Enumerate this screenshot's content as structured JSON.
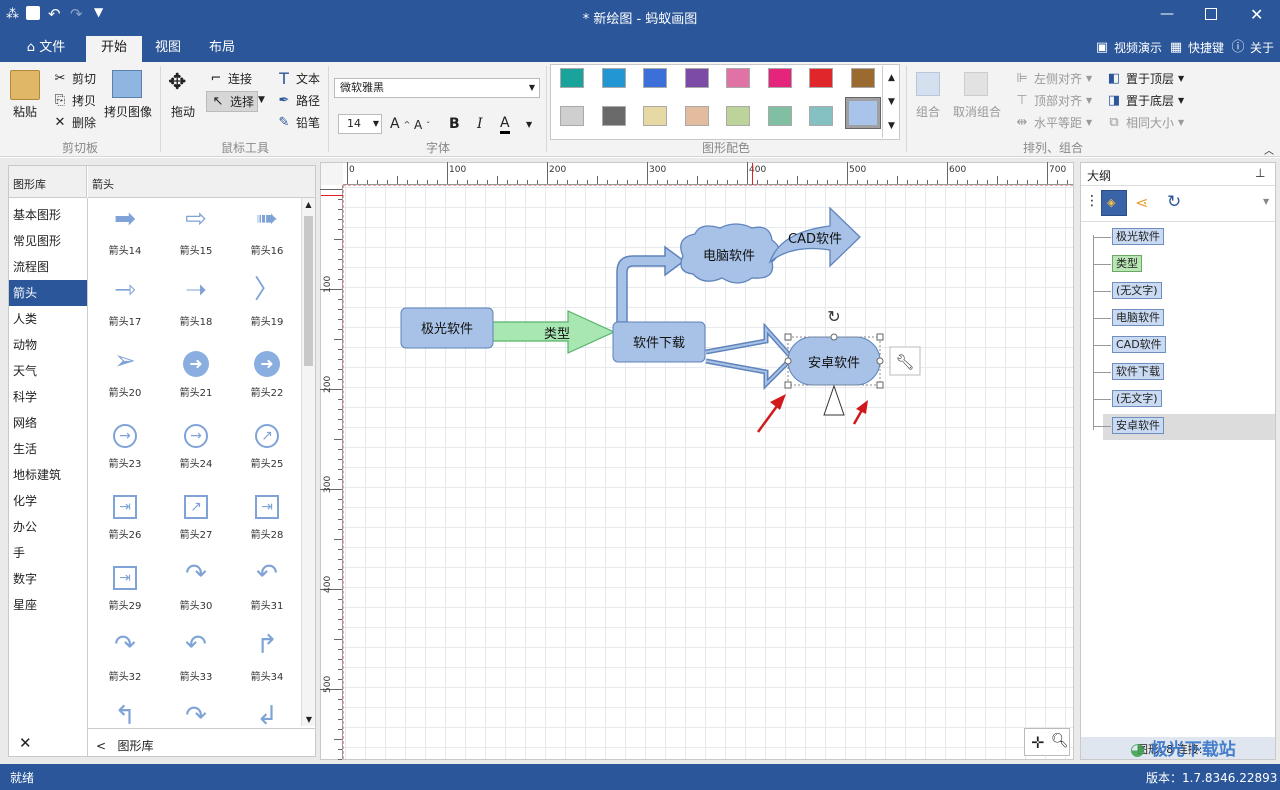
{
  "title": "* 新绘图 - 蚂蚁画图",
  "tabs": [
    "文件",
    "开始",
    "视图",
    "布局"
  ],
  "top_right": {
    "video": "视频演示",
    "shortcuts": "快捷键",
    "about": "关于"
  },
  "clipboard": {
    "paste": "粘贴",
    "cut": "剪切",
    "copy": "拷贝",
    "delete": "删除",
    "copy_image": "拷贝图像",
    "group_label": "剪切板"
  },
  "mouse_tools": {
    "drag": "拖动",
    "connect": "连接",
    "select": "选择",
    "text": "文本",
    "path": "路径",
    "pencil": "铅笔",
    "group_label": "鼠标工具"
  },
  "font": {
    "family": "微软雅黑",
    "size": "14",
    "bold": "B",
    "italic": "I",
    "color": "A",
    "grow": "A",
    "shrink": "A",
    "group_label": "字体"
  },
  "colors": {
    "group_label": "图形配色",
    "row1": [
      "#1aa39b",
      "#2196d3",
      "#3c6fd8",
      "#7b4ba6",
      "#e072a6",
      "#e5247b",
      "#e0262a",
      "#9a6a30"
    ],
    "row2": [
      "#cfcfcf",
      "#6a6a6a",
      "#e6d9a6",
      "#e3bb9f",
      "#bcd39a",
      "#80bfa1",
      "#85c0c2",
      "#a9c4ea"
    ]
  },
  "arrange": {
    "group": "组合",
    "ungroup": "取消组合",
    "align_left": "左侧对齐",
    "align_top": "顶部对齐",
    "equal_h": "水平等距",
    "to_top": "置于顶层",
    "to_bottom": "置于底层",
    "same_size": "相同大小",
    "group_label": "排列、组合"
  },
  "library": {
    "header": "图形库",
    "sub_header": "箭头",
    "categories": [
      "基本图形",
      "常见图形",
      "流程图",
      "箭头",
      "人类",
      "动物",
      "天气",
      "科学",
      "网络",
      "生活",
      "地标建筑",
      "化学",
      "办公",
      "手",
      "数字",
      "星座"
    ],
    "selected": "箭头",
    "shapes": [
      "箭头14",
      "箭头15",
      "箭头16",
      "箭头17",
      "箭头18",
      "箭头19",
      "箭头20",
      "箭头21",
      "箭头22",
      "箭头23",
      "箭头24",
      "箭头25",
      "箭头26",
      "箭头27",
      "箭头28",
      "箭头29",
      "箭头30",
      "箭头31",
      "箭头32",
      "箭头33",
      "箭头34"
    ],
    "footer": "图形库",
    "close": "✕"
  },
  "ruler": {
    "h": [
      "0",
      "100",
      "200",
      "300",
      "400",
      "500",
      "600",
      "700"
    ],
    "v": [
      "100",
      "200",
      "300",
      "400",
      "500"
    ]
  },
  "diagram": {
    "n1": "极光软件",
    "label": "类型",
    "n2": "软件下载",
    "n3": "电脑软件",
    "n4": "CAD软件",
    "n5": "安卓软件"
  },
  "outline": {
    "title": "大纲",
    "items": [
      "极光软件",
      "类型",
      "(无文字)",
      "电脑软件",
      "CAD软件",
      "软件下载",
      "(无文字)",
      "安卓软件"
    ],
    "footer_left": "图形: 8",
    "footer_right": "连接:"
  },
  "status": {
    "left": "就绪",
    "version": "版本：1.7.8346.22893"
  },
  "watermark": "极光下载站"
}
